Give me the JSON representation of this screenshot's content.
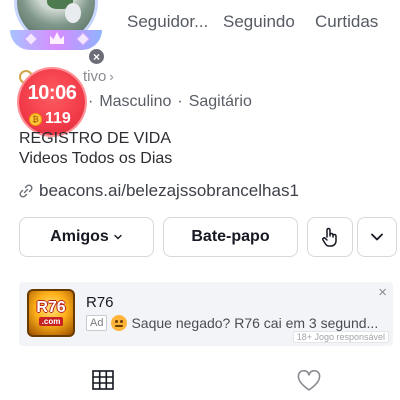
{
  "profile": {
    "stats": {
      "followers_label": "Seguidor...",
      "following_label": "Seguindo",
      "likes_label": "Curtidas"
    },
    "active_status": "tivo",
    "meta": {
      "gender": "Masculino",
      "separator": "·",
      "sign": "Sagitário"
    },
    "bio": {
      "line1": "REGISTRO DE VIDA",
      "line2": "Videos Todos os Dias"
    },
    "link": "beacons.ai/belezajssobrancelhas1"
  },
  "timer_badge": {
    "time": "10:06",
    "coins": "119",
    "coin_symbol": "₿"
  },
  "buttons": {
    "friends": "Amigos",
    "chat": "Bate-papo"
  },
  "ad": {
    "title": "R76",
    "badge": "Ad",
    "text": "Saque negado? R76 cai em 3 segund...",
    "rating": "18+ Jogo responsável",
    "logo_main": "R76",
    "logo_sub": ".com",
    "close_symbol": "×"
  },
  "icons": {
    "grid": "grid-icon",
    "heart": "heart-outline-icon",
    "share": "share-hand-icon",
    "more": "chevron-down-icon",
    "link": "link-icon"
  },
  "colors": {
    "timer_red": "#f23b4a",
    "coin_gold": "#ffc640",
    "text_primary": "#161823",
    "text_secondary": "#555a63"
  }
}
